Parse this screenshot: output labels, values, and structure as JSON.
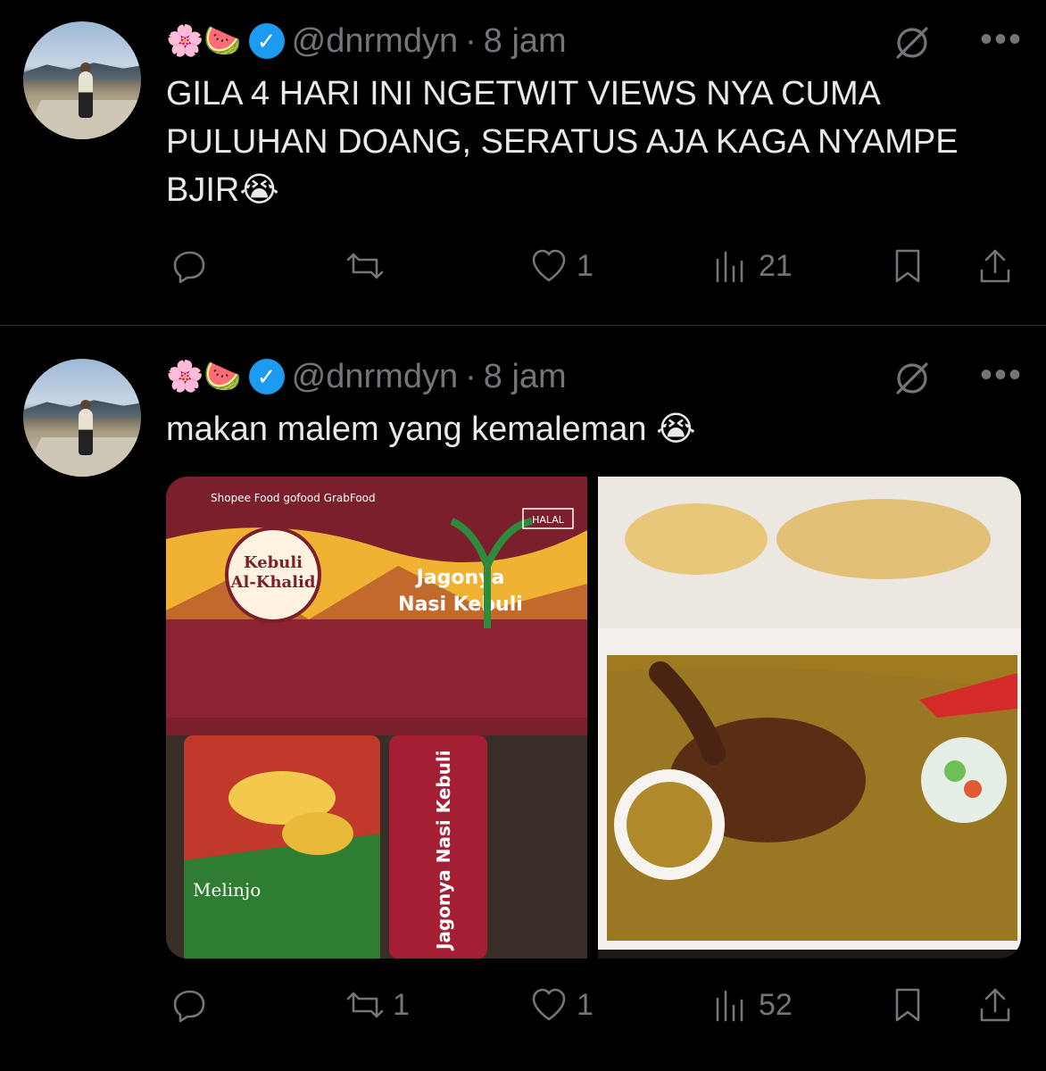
{
  "tweets": [
    {
      "display_emojis": "🌸🍉",
      "handle": "@dnrmdyn",
      "sep": "·",
      "time": "8 jam",
      "text": "GILA 4 HARI INI NGETWIT VIEWS NYA CUMA PULUHAN DOANG, SERATUS AJA KAGA NYAMPE BJIR😭",
      "reply_count": "",
      "retweet_count": "",
      "like_count": "1",
      "views_count": "21"
    },
    {
      "display_emojis": "🌸🍉",
      "handle": "@dnrmdyn",
      "sep": "·",
      "time": "8 jam",
      "text": "makan malem yang kemaleman 😭",
      "reply_count": "",
      "retweet_count": "1",
      "like_count": "1",
      "views_count": "52"
    }
  ],
  "media": {
    "photo1_box": {
      "brand": "Kebuli Al-Khalid",
      "slogan": "Jagonya Nasi Kebuli",
      "delivery": [
        "Shopee Food",
        "gofood",
        "GrabFood"
      ],
      "halal": "HALAL",
      "chips": "Emping Goreng Melinjo"
    },
    "photo2_desc": "rice-chicken"
  },
  "colors": {
    "bg": "#000000",
    "text": "#e7e9ea",
    "muted": "#71767b",
    "verified": "#1d9bf0"
  }
}
